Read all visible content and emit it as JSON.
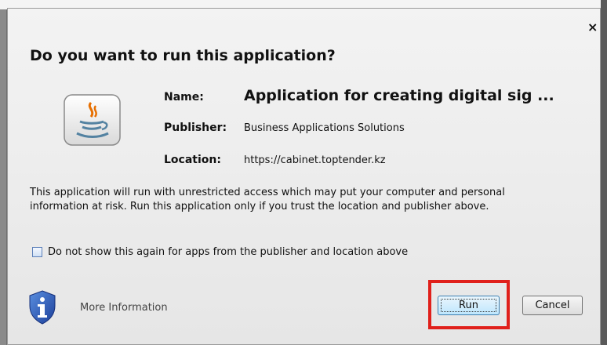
{
  "dialog": {
    "title": "Do you want to run this application?",
    "close_glyph": "×",
    "fields": {
      "name_label": "Name:",
      "name_value": "Application for creating digital sig ...",
      "publisher_label": "Publisher:",
      "publisher_value": "Business Applications Solutions",
      "location_label": "Location:",
      "location_value": "https://cabinet.toptender.kz"
    },
    "warning_line1": "This application will run with unrestricted access which may put your computer and personal",
    "warning_line2": "information at risk. Run this application only if you trust the location and publisher above.",
    "checkbox_label": "Do not show this again for apps from the publisher and location above",
    "checkbox_checked": false,
    "more_info_label": "More Information",
    "buttons": {
      "run": "Run",
      "cancel": "Cancel"
    },
    "icons": {
      "app": "java-icon",
      "info": "shield-info-icon"
    },
    "colors": {
      "highlight": "#e0201b",
      "run_border": "#3c7fb1"
    }
  }
}
